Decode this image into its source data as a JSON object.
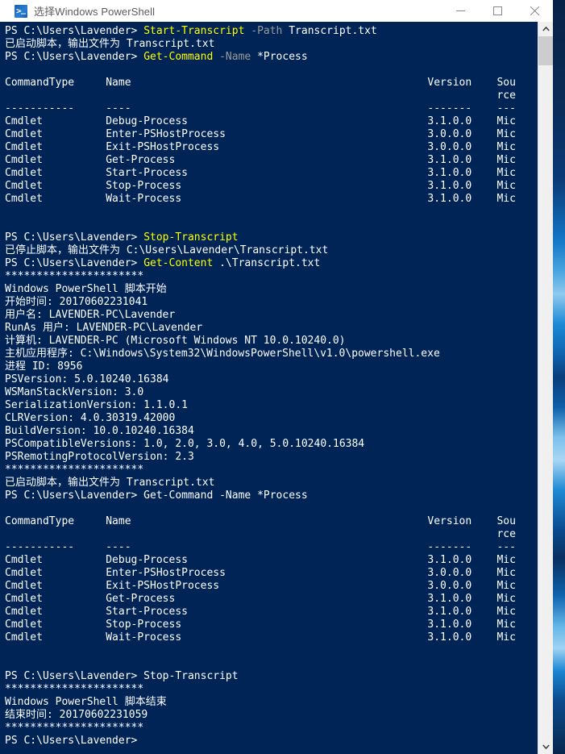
{
  "window": {
    "title": "选择Windows PowerShell",
    "app_icon": "powershell-icon",
    "controls": {
      "minimize": "minimize-icon",
      "maximize": "maximize-icon",
      "close": "close-icon"
    }
  },
  "scrollbar": {
    "up_arrow": "chevron-up-icon",
    "down_arrow": "chevron-down-icon"
  },
  "colors": {
    "console_background": "#012456",
    "foreground": "#ffffff",
    "command": "#ffff00",
    "parameter": "#9a9a9a",
    "titlebar": "#ffffff",
    "title_text": "#5c5c5c"
  },
  "console": {
    "prompt": "PS C:\\Users\\Lavender>",
    "lines": [
      {
        "id": "l01",
        "segs": [
          {
            "t": "PS C:\\Users\\Lavender> ",
            "c": "white"
          },
          {
            "t": "Start-Transcript",
            "c": "yellow"
          },
          {
            "t": " ",
            "c": "white"
          },
          {
            "t": "-Path",
            "c": "gray"
          },
          {
            "t": " Transcript.txt",
            "c": "white"
          }
        ]
      },
      {
        "id": "l02",
        "segs": [
          {
            "t": "已启动脚本，输出文件为 Transcript.txt",
            "c": "white"
          }
        ]
      },
      {
        "id": "l03",
        "segs": [
          {
            "t": "PS C:\\Users\\Lavender> ",
            "c": "white"
          },
          {
            "t": "Get-Command",
            "c": "yellow"
          },
          {
            "t": " ",
            "c": "white"
          },
          {
            "t": "-Name",
            "c": "gray"
          },
          {
            "t": " *Process",
            "c": "white"
          }
        ]
      },
      {
        "id": "l04",
        "segs": [
          {
            "t": "",
            "c": "white"
          }
        ]
      },
      {
        "id": "l05",
        "segs": [
          {
            "t": "CommandType     Name                                               Version    Sou",
            "c": "white"
          }
        ]
      },
      {
        "id": "l06",
        "segs": [
          {
            "t": "                                                                              rce",
            "c": "white"
          }
        ]
      },
      {
        "id": "l07",
        "segs": [
          {
            "t": "-----------     ----                                               -------    ---",
            "c": "white"
          }
        ]
      },
      {
        "id": "l08",
        "segs": [
          {
            "t": "Cmdlet          Debug-Process                                      3.1.0.0    Mic",
            "c": "white"
          }
        ]
      },
      {
        "id": "l09",
        "segs": [
          {
            "t": "Cmdlet          Enter-PSHostProcess                                3.0.0.0    Mic",
            "c": "white"
          }
        ]
      },
      {
        "id": "l10",
        "segs": [
          {
            "t": "Cmdlet          Exit-PSHostProcess                                 3.0.0.0    Mic",
            "c": "white"
          }
        ]
      },
      {
        "id": "l11",
        "segs": [
          {
            "t": "Cmdlet          Get-Process                                        3.1.0.0    Mic",
            "c": "white"
          }
        ]
      },
      {
        "id": "l12",
        "segs": [
          {
            "t": "Cmdlet          Start-Process                                      3.1.0.0    Mic",
            "c": "white"
          }
        ]
      },
      {
        "id": "l13",
        "segs": [
          {
            "t": "Cmdlet          Stop-Process                                       3.1.0.0    Mic",
            "c": "white"
          }
        ]
      },
      {
        "id": "l14",
        "segs": [
          {
            "t": "Cmdlet          Wait-Process                                       3.1.0.0    Mic",
            "c": "white"
          }
        ]
      },
      {
        "id": "l15",
        "segs": [
          {
            "t": "",
            "c": "white"
          }
        ]
      },
      {
        "id": "l16",
        "segs": [
          {
            "t": "",
            "c": "white"
          }
        ]
      },
      {
        "id": "l17",
        "segs": [
          {
            "t": "PS C:\\Users\\Lavender> ",
            "c": "white"
          },
          {
            "t": "Stop-Transcript",
            "c": "yellow"
          }
        ]
      },
      {
        "id": "l18",
        "segs": [
          {
            "t": "已停止脚本，输出文件为 C:\\Users\\Lavender\\Transcript.txt",
            "c": "white"
          }
        ]
      },
      {
        "id": "l19",
        "segs": [
          {
            "t": "PS C:\\Users\\Lavender> ",
            "c": "white"
          },
          {
            "t": "Get-Content",
            "c": "yellow"
          },
          {
            "t": " .\\Transcript.txt",
            "c": "white"
          }
        ]
      },
      {
        "id": "l20",
        "segs": [
          {
            "t": "**********************",
            "c": "white"
          }
        ]
      },
      {
        "id": "l21",
        "segs": [
          {
            "t": "Windows PowerShell 脚本开始",
            "c": "white"
          }
        ]
      },
      {
        "id": "l22",
        "segs": [
          {
            "t": "开始时间: 20170602231041",
            "c": "white"
          }
        ]
      },
      {
        "id": "l23",
        "segs": [
          {
            "t": "用户名: LAVENDER-PC\\Lavender",
            "c": "white"
          }
        ]
      },
      {
        "id": "l24",
        "segs": [
          {
            "t": "RunAs 用户: LAVENDER-PC\\Lavender",
            "c": "white"
          }
        ]
      },
      {
        "id": "l25",
        "segs": [
          {
            "t": "计算机: LAVENDER-PC (Microsoft Windows NT 10.0.10240.0)",
            "c": "white"
          }
        ]
      },
      {
        "id": "l26",
        "segs": [
          {
            "t": "主机应用程序: C:\\Windows\\System32\\WindowsPowerShell\\v1.0\\powershell.exe",
            "c": "white"
          }
        ]
      },
      {
        "id": "l27",
        "segs": [
          {
            "t": "进程 ID: 8956",
            "c": "white"
          }
        ]
      },
      {
        "id": "l28",
        "segs": [
          {
            "t": "PSVersion: 5.0.10240.16384",
            "c": "white"
          }
        ]
      },
      {
        "id": "l29",
        "segs": [
          {
            "t": "WSManStackVersion: 3.0",
            "c": "white"
          }
        ]
      },
      {
        "id": "l30",
        "segs": [
          {
            "t": "SerializationVersion: 1.1.0.1",
            "c": "white"
          }
        ]
      },
      {
        "id": "l31",
        "segs": [
          {
            "t": "CLRVersion: 4.0.30319.42000",
            "c": "white"
          }
        ]
      },
      {
        "id": "l32",
        "segs": [
          {
            "t": "BuildVersion: 10.0.10240.16384",
            "c": "white"
          }
        ]
      },
      {
        "id": "l33",
        "segs": [
          {
            "t": "PSCompatibleVersions: 1.0, 2.0, 3.0, 4.0, 5.0.10240.16384",
            "c": "white"
          }
        ]
      },
      {
        "id": "l34",
        "segs": [
          {
            "t": "PSRemotingProtocolVersion: 2.3",
            "c": "white"
          }
        ]
      },
      {
        "id": "l35",
        "segs": [
          {
            "t": "**********************",
            "c": "white"
          }
        ]
      },
      {
        "id": "l36",
        "segs": [
          {
            "t": "已启动脚本，输出文件为 Transcript.txt",
            "c": "white"
          }
        ]
      },
      {
        "id": "l37",
        "segs": [
          {
            "t": "PS C:\\Users\\Lavender> Get-Command -Name *Process",
            "c": "white"
          }
        ]
      },
      {
        "id": "l38",
        "segs": [
          {
            "t": "",
            "c": "white"
          }
        ]
      },
      {
        "id": "l39",
        "segs": [
          {
            "t": "CommandType     Name                                               Version    Sou",
            "c": "white"
          }
        ]
      },
      {
        "id": "l40",
        "segs": [
          {
            "t": "                                                                              rce",
            "c": "white"
          }
        ]
      },
      {
        "id": "l41",
        "segs": [
          {
            "t": "-----------     ----                                               -------    ---",
            "c": "white"
          }
        ]
      },
      {
        "id": "l42",
        "segs": [
          {
            "t": "Cmdlet          Debug-Process                                      3.1.0.0    Mic",
            "c": "white"
          }
        ]
      },
      {
        "id": "l43",
        "segs": [
          {
            "t": "Cmdlet          Enter-PSHostProcess                                3.0.0.0    Mic",
            "c": "white"
          }
        ]
      },
      {
        "id": "l44",
        "segs": [
          {
            "t": "Cmdlet          Exit-PSHostProcess                                 3.0.0.0    Mic",
            "c": "white"
          }
        ]
      },
      {
        "id": "l45",
        "segs": [
          {
            "t": "Cmdlet          Get-Process                                        3.1.0.0    Mic",
            "c": "white"
          }
        ]
      },
      {
        "id": "l46",
        "segs": [
          {
            "t": "Cmdlet          Start-Process                                      3.1.0.0    Mic",
            "c": "white"
          }
        ]
      },
      {
        "id": "l47",
        "segs": [
          {
            "t": "Cmdlet          Stop-Process                                       3.1.0.0    Mic",
            "c": "white"
          }
        ]
      },
      {
        "id": "l48",
        "segs": [
          {
            "t": "Cmdlet          Wait-Process                                       3.1.0.0    Mic",
            "c": "white"
          }
        ]
      },
      {
        "id": "l49",
        "segs": [
          {
            "t": "",
            "c": "white"
          }
        ]
      },
      {
        "id": "l50",
        "segs": [
          {
            "t": "",
            "c": "white"
          }
        ]
      },
      {
        "id": "l51",
        "segs": [
          {
            "t": "PS C:\\Users\\Lavender> Stop-Transcript",
            "c": "white"
          }
        ]
      },
      {
        "id": "l52",
        "segs": [
          {
            "t": "**********************",
            "c": "white"
          }
        ]
      },
      {
        "id": "l53",
        "segs": [
          {
            "t": "Windows PowerShell 脚本结束",
            "c": "white"
          }
        ]
      },
      {
        "id": "l54",
        "segs": [
          {
            "t": "结束时间: 20170602231059",
            "c": "white"
          }
        ]
      },
      {
        "id": "l55",
        "segs": [
          {
            "t": "**********************",
            "c": "white"
          }
        ]
      },
      {
        "id": "l56",
        "segs": [
          {
            "t": "PS C:\\Users\\Lavender>",
            "c": "white"
          }
        ]
      }
    ]
  },
  "table": {
    "headers": [
      "CommandType",
      "Name",
      "Version",
      "Source"
    ],
    "rows": [
      {
        "command_type": "Cmdlet",
        "name": "Debug-Process",
        "version": "3.1.0.0",
        "source": "Mic"
      },
      {
        "command_type": "Cmdlet",
        "name": "Enter-PSHostProcess",
        "version": "3.0.0.0",
        "source": "Mic"
      },
      {
        "command_type": "Cmdlet",
        "name": "Exit-PSHostProcess",
        "version": "3.0.0.0",
        "source": "Mic"
      },
      {
        "command_type": "Cmdlet",
        "name": "Get-Process",
        "version": "3.1.0.0",
        "source": "Mic"
      },
      {
        "command_type": "Cmdlet",
        "name": "Start-Process",
        "version": "3.1.0.0",
        "source": "Mic"
      },
      {
        "command_type": "Cmdlet",
        "name": "Stop-Process",
        "version": "3.1.0.0",
        "source": "Mic"
      },
      {
        "command_type": "Cmdlet",
        "name": "Wait-Process",
        "version": "3.1.0.0",
        "source": "Mic"
      }
    ]
  },
  "transcript_info": {
    "start_time": "20170602231041",
    "end_time": "20170602231059",
    "username": "LAVENDER-PC\\Lavender",
    "runas_user": "LAVENDER-PC\\Lavender",
    "machine": "LAVENDER-PC (Microsoft Windows NT 10.0.10240.0)",
    "host_application": "C:\\Windows\\System32\\WindowsPowerShell\\v1.0\\powershell.exe",
    "process_id": "8956",
    "ps_version": "5.0.10240.16384",
    "wsman_stack_version": "3.0",
    "serialization_version": "1.1.0.1",
    "clr_version": "4.0.30319.42000",
    "build_version": "10.0.10240.16384",
    "ps_compatible_versions": "1.0, 2.0, 3.0, 4.0, 5.0.10240.16384",
    "ps_remoting_protocol_version": "2.3",
    "transcript_file": "Transcript.txt",
    "transcript_full_path": "C:\\Users\\Lavender\\Transcript.txt"
  }
}
